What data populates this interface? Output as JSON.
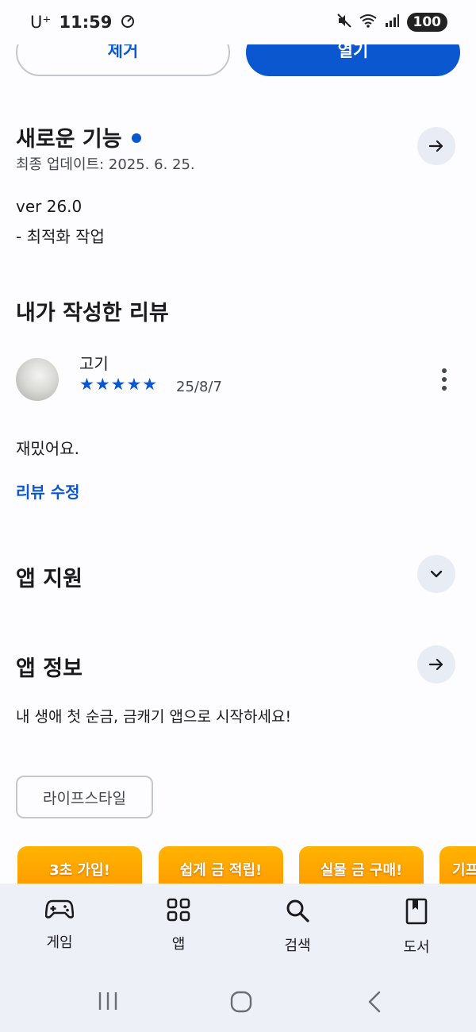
{
  "status_bar": {
    "carrier": "U⁺",
    "time": "11:59",
    "battery": "100"
  },
  "actions": {
    "remove_label": "제거",
    "open_label": "열기"
  },
  "whats_new": {
    "title": "새로운 기능",
    "last_updated": "최종 업데이트: 2025. 6. 25.",
    "version": "ver 26.0",
    "notes": "- 최적화 작업"
  },
  "my_review": {
    "title": "내가 작성한 리뷰",
    "reviewer": "고기",
    "rating": 5,
    "stars": "★★★★★",
    "date": "25/8/7",
    "text": "재밌어요.",
    "edit_label": "리뷰 수정"
  },
  "app_support": {
    "title": "앱 지원"
  },
  "app_info": {
    "title": "앱 정보",
    "description": "내 생애 첫 순금, 금캐기 앱으로 시작하세요!",
    "category_chip": "라이프스타일",
    "screenshots": [
      "3초 가입!",
      "쉽게 금 적립!",
      "실물 금 구매!",
      "기프"
    ]
  },
  "bottom_nav": {
    "items": [
      {
        "label": "게임",
        "icon": "gamepad-icon"
      },
      {
        "label": "앱",
        "icon": "apps-grid-icon"
      },
      {
        "label": "검색",
        "icon": "search-icon"
      },
      {
        "label": "도서",
        "icon": "book-icon"
      }
    ]
  },
  "colors": {
    "accent": "#0b57d0",
    "background": "#fdfcff",
    "nav_background": "#edf0f7",
    "screenshot_orange": "#ffa000"
  }
}
